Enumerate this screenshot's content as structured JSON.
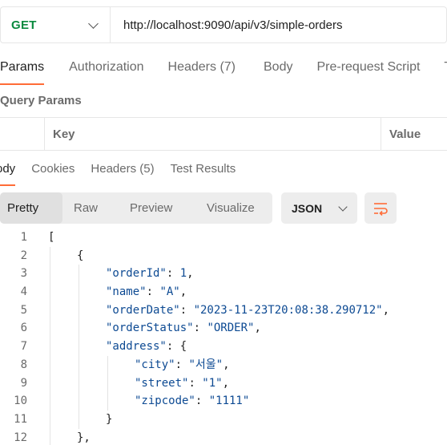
{
  "request": {
    "method": "GET",
    "url": "http://localhost:9090/api/v3/simple-orders"
  },
  "request_tabs": [
    "Params",
    "Authorization",
    "Headers (7)",
    "Body",
    "Pre-request Script",
    "T"
  ],
  "query_params": {
    "title": "Query Params",
    "columns": [
      "Key",
      "Value"
    ]
  },
  "response_tabs": [
    "ody",
    "Cookies",
    "Headers (5)",
    "Test Results"
  ],
  "view_modes": [
    "Pretty",
    "Raw",
    "Preview",
    "Visualize"
  ],
  "format": "JSON",
  "colors": {
    "accent": "#ff6c37",
    "method_get": "#0b8a3f",
    "json_text": "#0d4a93"
  },
  "icons": {
    "method_dropdown": "chevron-down-icon",
    "format_dropdown": "chevron-down-icon",
    "wrap": "wrap-lines-icon"
  },
  "code_lines": [
    {
      "n": "1",
      "indent": 0,
      "parts": [
        [
          "p",
          "["
        ]
      ]
    },
    {
      "n": "2",
      "indent": 1,
      "parts": [
        [
          "p",
          "{"
        ]
      ]
    },
    {
      "n": "3",
      "indent": 2,
      "parts": [
        [
          "k",
          "\"orderId\""
        ],
        [
          "p",
          ": "
        ],
        [
          "n",
          "1"
        ],
        [
          "p",
          ","
        ]
      ]
    },
    {
      "n": "4",
      "indent": 2,
      "parts": [
        [
          "k",
          "\"name\""
        ],
        [
          "p",
          ": "
        ],
        [
          "s",
          "\"A\""
        ],
        [
          "p",
          ","
        ]
      ]
    },
    {
      "n": "5",
      "indent": 2,
      "parts": [
        [
          "k",
          "\"orderDate\""
        ],
        [
          "p",
          ": "
        ],
        [
          "s",
          "\"2023-11-23T20:08:38.290712\""
        ],
        [
          "p",
          ","
        ]
      ]
    },
    {
      "n": "6",
      "indent": 2,
      "parts": [
        [
          "k",
          "\"orderStatus\""
        ],
        [
          "p",
          ": "
        ],
        [
          "s",
          "\"ORDER\""
        ],
        [
          "p",
          ","
        ]
      ]
    },
    {
      "n": "7",
      "indent": 2,
      "parts": [
        [
          "k",
          "\"address\""
        ],
        [
          "p",
          ": {"
        ]
      ]
    },
    {
      "n": "8",
      "indent": 3,
      "parts": [
        [
          "k",
          "\"city\""
        ],
        [
          "p",
          ": "
        ],
        [
          "s",
          "\"서울\""
        ],
        [
          "p",
          ","
        ]
      ]
    },
    {
      "n": "9",
      "indent": 3,
      "parts": [
        [
          "k",
          "\"street\""
        ],
        [
          "p",
          ": "
        ],
        [
          "s",
          "\"1\""
        ],
        [
          "p",
          ","
        ]
      ]
    },
    {
      "n": "10",
      "indent": 3,
      "parts": [
        [
          "k",
          "\"zipcode\""
        ],
        [
          "p",
          ": "
        ],
        [
          "s",
          "\"1111\""
        ]
      ]
    },
    {
      "n": "11",
      "indent": 2,
      "parts": [
        [
          "p",
          "}"
        ]
      ]
    },
    {
      "n": "12",
      "indent": 1,
      "parts": [
        [
          "p",
          "},"
        ]
      ]
    }
  ]
}
